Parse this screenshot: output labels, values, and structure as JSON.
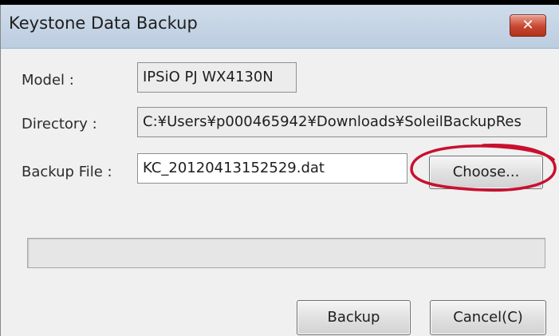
{
  "window": {
    "title": "Keystone Data Backup",
    "close_symbol": "✕",
    "accent_close": "#c7462f"
  },
  "form": {
    "model_label": "Model :",
    "model_value": "IPSiO PJ WX4130N",
    "directory_label": "Directory :",
    "directory_value": "C:¥Users¥p000465942¥Downloads¥SoleilBackupRes",
    "backup_file_label": "Backup File :",
    "backup_file_value": "KC_20120413152529.dat",
    "choose_label": "Choose..."
  },
  "progress": {
    "fraction": 0
  },
  "buttons": {
    "backup_label": "Backup",
    "cancel_label": "Cancel(C)"
  },
  "annotation": {
    "color": "#c8102e"
  }
}
